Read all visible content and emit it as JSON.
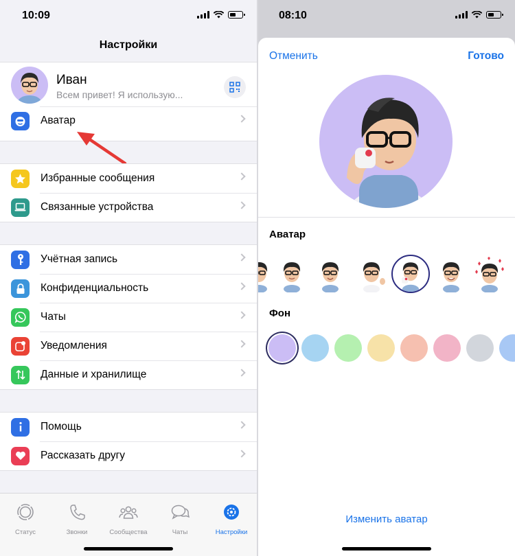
{
  "left": {
    "status_time": "10:09",
    "nav_title": "Настройки",
    "profile": {
      "name": "Иван",
      "status": "Всем привет! Я использую..."
    },
    "groups": [
      {
        "items": [
          {
            "label": "Аватар",
            "icon": "avatar-icon",
            "color": "#2f6fe4"
          }
        ]
      },
      {
        "items": [
          {
            "label": "Избранные сообщения",
            "icon": "star-icon",
            "color": "#f5c71e"
          },
          {
            "label": "Связанные устройства",
            "icon": "laptop-icon",
            "color": "#2e9a8c"
          }
        ]
      },
      {
        "items": [
          {
            "label": "Учётная запись",
            "icon": "key-icon",
            "color": "#2f6fe4"
          },
          {
            "label": "Конфиденциальность",
            "icon": "lock-icon",
            "color": "#3b95db"
          },
          {
            "label": "Чаты",
            "icon": "whatsapp-icon",
            "color": "#36c75b"
          },
          {
            "label": "Уведомления",
            "icon": "notification-icon",
            "color": "#ea4335"
          },
          {
            "label": "Данные и хранилище",
            "icon": "transfer-icon",
            "color": "#36c75b"
          }
        ]
      },
      {
        "items": [
          {
            "label": "Помощь",
            "icon": "info-icon",
            "color": "#2f6fe4"
          },
          {
            "label": "Рассказать другу",
            "icon": "heart-icon",
            "color": "#ea3e55"
          }
        ]
      }
    ],
    "tabs": [
      {
        "label": "Статус",
        "icon": "status-icon"
      },
      {
        "label": "Звонки",
        "icon": "phone-icon"
      },
      {
        "label": "Сообщества",
        "icon": "community-icon"
      },
      {
        "label": "Чаты",
        "icon": "chats-icon"
      },
      {
        "label": "Настройки",
        "icon": "settings-icon",
        "active": true
      }
    ]
  },
  "right": {
    "status_time": "08:10",
    "cancel_label": "Отменить",
    "done_label": "Готово",
    "avatar_section_title": "Аватар",
    "background_section_title": "Фон",
    "change_avatar_label": "Изменить аватар",
    "background_colors": [
      "#cbbdf5",
      "#a6d4f2",
      "#b5f0b0",
      "#f7e2a8",
      "#f6c0b0",
      "#f2b4c7",
      "#d2d6dc",
      "#a8c8f5"
    ],
    "selected_background_index": 0,
    "selected_sticker_index": 4
  },
  "colors": {
    "accent": "#1a73e8",
    "arrow": "#e53935"
  }
}
